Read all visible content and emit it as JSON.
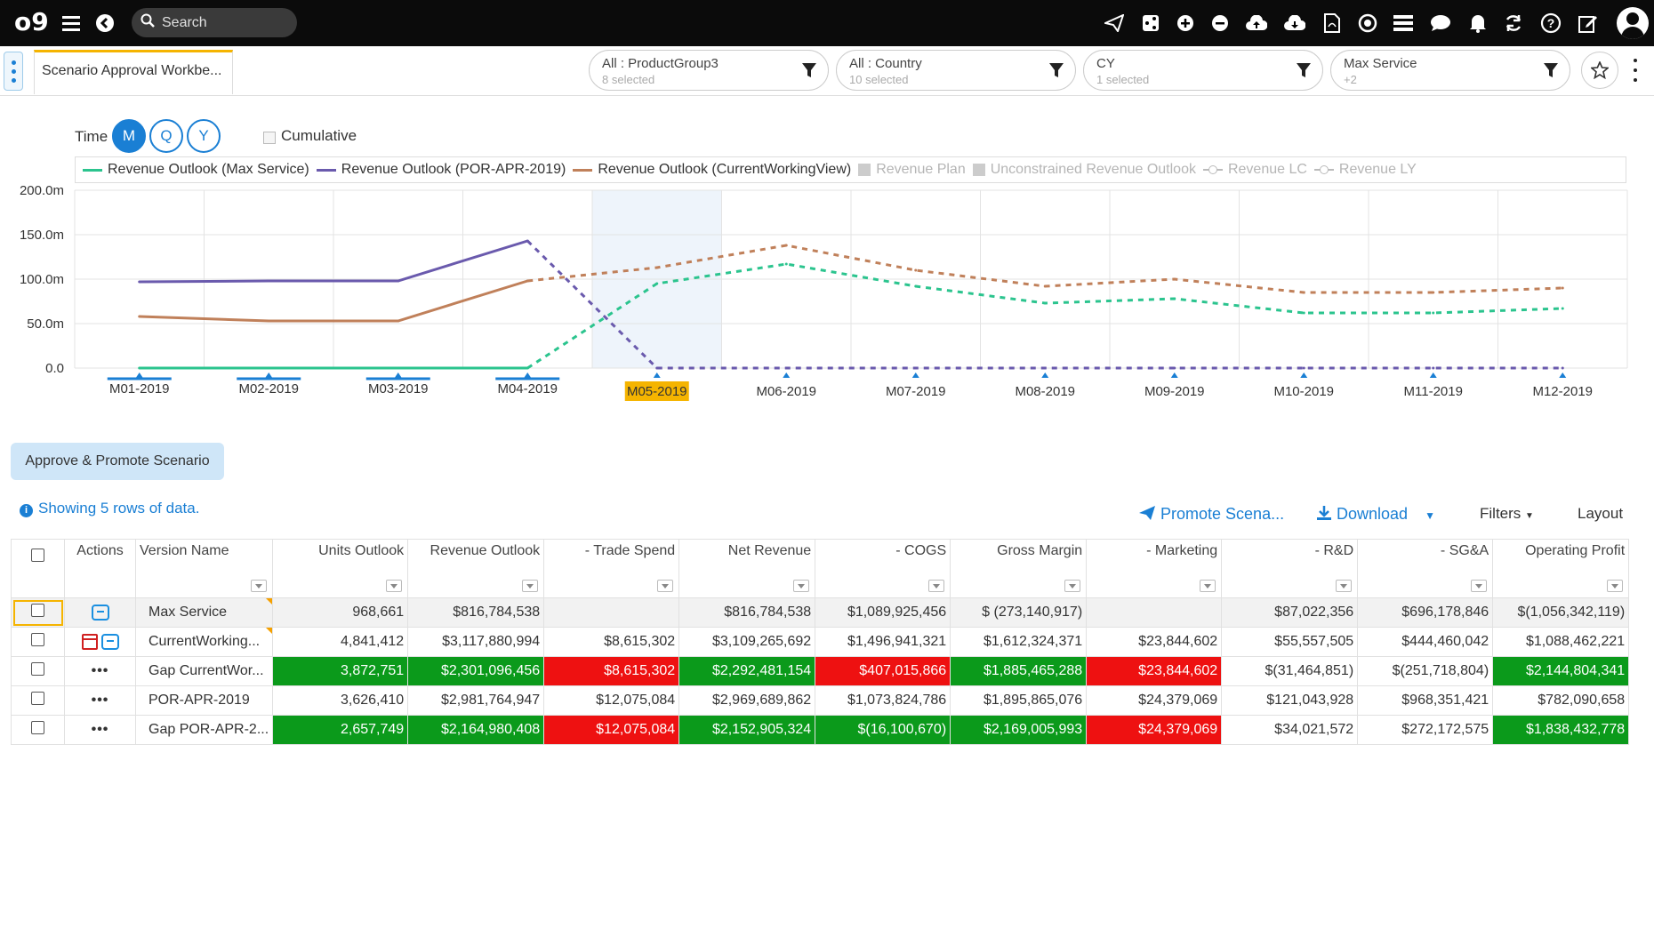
{
  "topbar": {
    "logo_text": "o9",
    "search_placeholder": "Search",
    "icons": [
      "send-icon",
      "share-icon",
      "plus-circle-icon",
      "minus-circle-icon",
      "cloud-upload-icon",
      "cloud-download-icon",
      "pdf-icon",
      "target-icon",
      "list-icon",
      "chat-icon",
      "bell-icon",
      "refresh-icon",
      "help-icon",
      "edit-icon",
      "user-avatar"
    ]
  },
  "tab": {
    "label": "Scenario Approval Workbe..."
  },
  "filters": [
    {
      "title": "All : ProductGroup3",
      "sub": "8 selected"
    },
    {
      "title": "All : Country",
      "sub": "10 selected"
    },
    {
      "title": "CY",
      "sub": "1 selected"
    },
    {
      "title": "Max Service",
      "sub": "+2"
    }
  ],
  "controls": {
    "time_label": "Time",
    "time_buttons": [
      "M",
      "Q",
      "Y"
    ],
    "active_time": "M",
    "cumulative_label": "Cumulative"
  },
  "legend": [
    {
      "label": "Revenue Outlook (Max Service)",
      "color": "#2bc48e",
      "kind": "line",
      "dim": false
    },
    {
      "label": "Revenue Outlook (POR-APR-2019)",
      "color": "#6a5aad",
      "kind": "line",
      "dim": false
    },
    {
      "label": "Revenue Outlook (CurrentWorkingView)",
      "color": "#c0805a",
      "kind": "line",
      "dim": false
    },
    {
      "label": "Revenue Plan",
      "color": "#cccccc",
      "kind": "square",
      "dim": true
    },
    {
      "label": "Unconstrained Revenue Outlook",
      "color": "#cccccc",
      "kind": "square",
      "dim": true
    },
    {
      "label": "Revenue LC",
      "color": "#bbbbbb",
      "kind": "circle",
      "dim": true
    },
    {
      "label": "Revenue LY",
      "color": "#bbbbbb",
      "kind": "circle",
      "dim": true
    }
  ],
  "chart_data": {
    "type": "line",
    "categories": [
      "M01-2019",
      "M02-2019",
      "M03-2019",
      "M04-2019",
      "M05-2019",
      "M06-2019",
      "M07-2019",
      "M08-2019",
      "M09-2019",
      "M10-2019",
      "M11-2019",
      "M12-2019"
    ],
    "highlighted_category": "M05-2019",
    "y_ticks": [
      "0.0",
      "50.0m",
      "100.0m",
      "150.0m",
      "200.0m"
    ],
    "ylim": [
      0,
      200
    ],
    "y_unit": "m",
    "actuals_through_index": 3,
    "series": [
      {
        "name": "Revenue Outlook (Max Service)",
        "color": "#2bc48e",
        "values": [
          0,
          0,
          0,
          0,
          95,
          117,
          92,
          73,
          78,
          62,
          62,
          67
        ]
      },
      {
        "name": "Revenue Outlook (POR-APR-2019)",
        "color": "#6a5aad",
        "values": [
          97,
          98,
          98,
          143,
          0,
          0,
          0,
          0,
          0,
          0,
          0,
          0
        ]
      },
      {
        "name": "Revenue Outlook (CurrentWorkingView)",
        "color": "#c0805a",
        "values": [
          58,
          53,
          53,
          98,
          113,
          138,
          110,
          92,
          100,
          85,
          85,
          90
        ]
      }
    ]
  },
  "approve_button": "Approve & Promote Scenario",
  "showing_text": "Showing 5 rows of data.",
  "toolbar": {
    "promote": "Promote Scena...",
    "download": "Download",
    "filters": "Filters",
    "layout": "Layout"
  },
  "table": {
    "headers": [
      "Actions",
      "Version Name",
      "Units Outlook",
      "Revenue Outlook",
      "- Trade Spend",
      "Net Revenue",
      "- COGS",
      "Gross Margin",
      "- Marketing",
      "- R&D",
      "- SG&A",
      "Operating Profit"
    ],
    "rows": [
      {
        "actions": "chat",
        "name": "Max Service",
        "cells": [
          "968,661",
          "$816,784,538",
          "",
          "$816,784,538",
          "$1,089,925,456",
          "$ (273,140,917)",
          "",
          "$87,022,356",
          "$696,178,846",
          "$(1,056,342,119)"
        ],
        "colors": [
          "",
          "",
          "",
          "",
          "",
          "",
          "",
          "",
          "",
          ""
        ]
      },
      {
        "actions": "cal-chat",
        "name": "CurrentWorking...",
        "cells": [
          "4,841,412",
          "$3,117,880,994",
          "$8,615,302",
          "$3,109,265,692",
          "$1,496,941,321",
          "$1,612,324,371",
          "$23,844,602",
          "$55,557,505",
          "$444,460,042",
          "$1,088,462,221"
        ],
        "colors": [
          "",
          "",
          "",
          "",
          "",
          "",
          "",
          "",
          "",
          ""
        ]
      },
      {
        "actions": "dots",
        "name": "Gap CurrentWor...",
        "cells": [
          "3,872,751",
          "$2,301,096,456",
          "$8,615,302",
          "$2,292,481,154",
          "$407,015,866",
          "$1,885,465,288",
          "$23,844,602",
          "$(31,464,851)",
          "$(251,718,804)",
          "$2,144,804,341"
        ],
        "colors": [
          "green",
          "green",
          "red",
          "green",
          "red",
          "green",
          "red",
          "",
          "",
          "green"
        ]
      },
      {
        "actions": "dots",
        "name": "POR-APR-2019",
        "cells": [
          "3,626,410",
          "$2,981,764,947",
          "$12,075,084",
          "$2,969,689,862",
          "$1,073,824,786",
          "$1,895,865,076",
          "$24,379,069",
          "$121,043,928",
          "$968,351,421",
          "$782,090,658"
        ],
        "colors": [
          "",
          "",
          "",
          "",
          "",
          "",
          "",
          "",
          "",
          ""
        ]
      },
      {
        "actions": "dots",
        "name": "Gap POR-APR-2...",
        "cells": [
          "2,657,749",
          "$2,164,980,408",
          "$12,075,084",
          "$2,152,905,324",
          "$(16,100,670)",
          "$2,169,005,993",
          "$24,379,069",
          "$34,021,572",
          "$272,172,575",
          "$1,838,432,778"
        ],
        "colors": [
          "green",
          "green",
          "red",
          "green",
          "green",
          "green",
          "red",
          "",
          "",
          "green"
        ]
      }
    ]
  }
}
